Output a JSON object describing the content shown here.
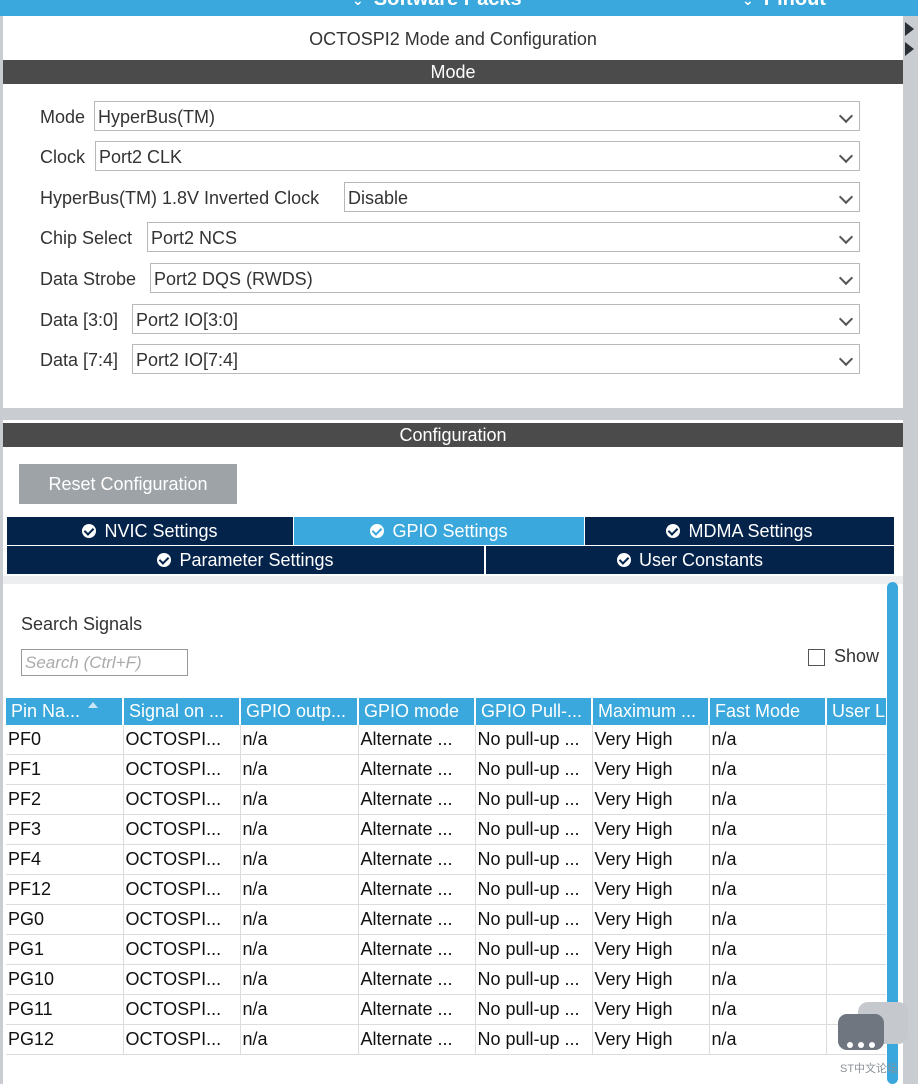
{
  "topbar": {
    "items": [
      {
        "label": "Software Packs",
        "chevron": "⌄"
      },
      {
        "label": "Pinout",
        "chevron": "⌄"
      }
    ]
  },
  "panel": {
    "title": "OCTOSPI2 Mode and Configuration"
  },
  "mode_section": {
    "title": "Mode",
    "rows": [
      {
        "label": "Mode",
        "value": "HyperBus(TM)"
      },
      {
        "label": "Clock",
        "value": "Port2 CLK"
      },
      {
        "label": "HyperBus(TM) 1.8V Inverted Clock",
        "value": "Disable"
      },
      {
        "label": "Chip Select",
        "value": "Port2 NCS"
      },
      {
        "label": "Data Strobe",
        "value": "Port2 DQS (RWDS)"
      },
      {
        "label": "Data [3:0]",
        "value": "Port2 IO[3:0]"
      },
      {
        "label": "Data [7:4]",
        "value": "Port2 IO[7:4]"
      }
    ]
  },
  "config_section": {
    "title": "Configuration",
    "reset_label": "Reset Configuration",
    "tabs": [
      {
        "label": "NVIC Settings",
        "active": false
      },
      {
        "label": "GPIO Settings",
        "active": true
      },
      {
        "label": "MDMA Settings",
        "active": false
      },
      {
        "label": "Parameter Settings",
        "active": false
      },
      {
        "label": "User Constants",
        "active": false
      }
    ],
    "search_label": "Search Signals",
    "search_placeholder": "Search (Ctrl+F)",
    "show_label": "Show",
    "table": {
      "columns": [
        "Pin Na...",
        "Signal on ...",
        "GPIO outp...",
        "GPIO mode",
        "GPIO Pull-...",
        "Maximum ...",
        "Fast Mode",
        "User L"
      ],
      "rows": [
        [
          "PF0",
          "OCTOSPI...",
          "n/a",
          "Alternate ...",
          "No pull-up ...",
          "Very High",
          "n/a",
          ""
        ],
        [
          "PF1",
          "OCTOSPI...",
          "n/a",
          "Alternate ...",
          "No pull-up ...",
          "Very High",
          "n/a",
          ""
        ],
        [
          "PF2",
          "OCTOSPI...",
          "n/a",
          "Alternate ...",
          "No pull-up ...",
          "Very High",
          "n/a",
          ""
        ],
        [
          "PF3",
          "OCTOSPI...",
          "n/a",
          "Alternate ...",
          "No pull-up ...",
          "Very High",
          "n/a",
          ""
        ],
        [
          "PF4",
          "OCTOSPI...",
          "n/a",
          "Alternate ...",
          "No pull-up ...",
          "Very High",
          "n/a",
          ""
        ],
        [
          "PF12",
          "OCTOSPI...",
          "n/a",
          "Alternate ...",
          "No pull-up ...",
          "Very High",
          "n/a",
          ""
        ],
        [
          "PG0",
          "OCTOSPI...",
          "n/a",
          "Alternate ...",
          "No pull-up ...",
          "Very High",
          "n/a",
          ""
        ],
        [
          "PG1",
          "OCTOSPI...",
          "n/a",
          "Alternate ...",
          "No pull-up ...",
          "Very High",
          "n/a",
          ""
        ],
        [
          "PG10",
          "OCTOSPI...",
          "n/a",
          "Alternate ...",
          "No pull-up ...",
          "Very High",
          "n/a",
          ""
        ],
        [
          "PG11",
          "OCTOSPI...",
          "n/a",
          "Alternate ...",
          "No pull-up ...",
          "Very High",
          "n/a",
          ""
        ],
        [
          "PG12",
          "OCTOSPI...",
          "n/a",
          "Alternate ...",
          "No pull-up ...",
          "Very High",
          "n/a",
          ""
        ]
      ]
    }
  },
  "watermark": {
    "text": "ST中文论坛"
  },
  "colors": {
    "accent": "#3aa8dc",
    "tab_dark": "#03234b",
    "section_bar": "#4b4b4b",
    "reset_button": "#9ea3a8"
  }
}
